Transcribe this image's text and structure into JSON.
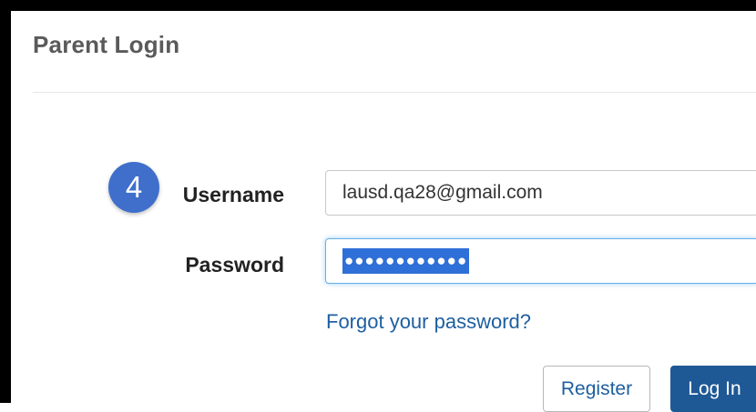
{
  "page": {
    "title": "Parent Login"
  },
  "step_badge": {
    "number": "4",
    "color": "#3f6fcb"
  },
  "form": {
    "username": {
      "label": "Username",
      "value": "lausd.qa28@gmail.com"
    },
    "password": {
      "label": "Password",
      "masked_value": "●●●●●●●●●●●●",
      "selected": true
    },
    "forgot_link": "Forgot your password?",
    "register_label": "Register",
    "login_label": "Log In"
  },
  "colors": {
    "title_text": "#5a5a5a",
    "link": "#1d5fa0",
    "primary_button": "#1e5996",
    "focus_border": "#66afe9"
  }
}
